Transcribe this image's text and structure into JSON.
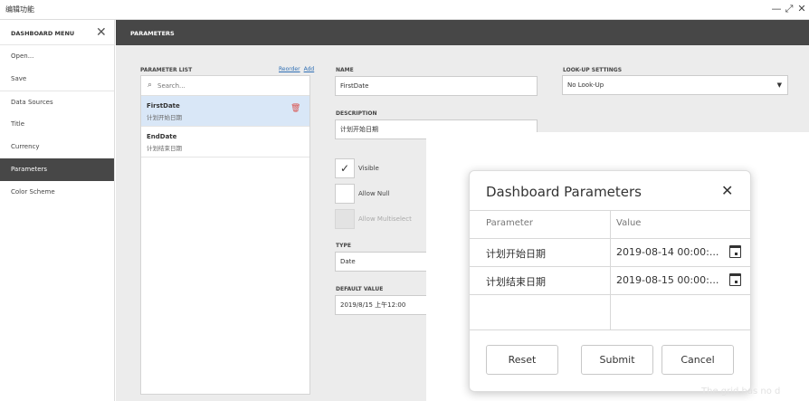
{
  "window": {
    "title": "编辑功能",
    "min_icon": "minimize-icon",
    "max_icon": "maximize-icon",
    "close_icon": "close-icon"
  },
  "sidebar": {
    "menu_title": "DASHBOARD MENU",
    "items": [
      {
        "label": "Open..."
      },
      {
        "label": "Save"
      },
      {
        "label": "Data Sources"
      },
      {
        "label": "Title"
      },
      {
        "label": "Currency"
      },
      {
        "label": "Parameters"
      },
      {
        "label": "Color Scheme"
      }
    ],
    "active_item": "Parameters"
  },
  "panel": {
    "title": "PARAMETERS",
    "parameter_list": {
      "label": "PARAMETER LIST",
      "reorder_label": "Reorder",
      "add_label": "Add",
      "search_placeholder": "Search...",
      "items": [
        {
          "name": "FirstDate",
          "description": "计划开始日期",
          "selected": true
        },
        {
          "name": "EndDate",
          "description": "计划结束日期",
          "selected": false
        }
      ]
    },
    "editor": {
      "name_label": "NAME",
      "name_value": "FirstDate",
      "description_label": "DESCRIPTION",
      "description_value": "计划开始日期",
      "visible_label": "Visible",
      "visible_checked": true,
      "allow_null_label": "Allow Null",
      "allow_null_checked": false,
      "allow_multiselect_label": "Allow Multiselect",
      "type_label": "TYPE",
      "type_value": "Date",
      "default_value_label": "DEFAULT VALUE",
      "default_value": "2019/8/15 上午12:00",
      "lookup_label": "LOOK-UP SETTINGS",
      "lookup_value": "No Look-Up"
    }
  },
  "dialog": {
    "title": "Dashboard Parameters",
    "col_parameter": "Parameter",
    "col_value": "Value",
    "rows": [
      {
        "parameter": "计划开始日期",
        "value": "2019-08-14 00:00:..."
      },
      {
        "parameter": "计划结束日期",
        "value": "2019-08-15 00:00:..."
      }
    ],
    "reset_label": "Reset",
    "submit_label": "Submit",
    "cancel_label": "Cancel"
  },
  "watermark": "The grid has no d",
  "colors": {
    "dark_header": "#474747",
    "selected_row": "#d9e7f7",
    "link": "#2f6fb4",
    "delete": "#d9534f"
  }
}
